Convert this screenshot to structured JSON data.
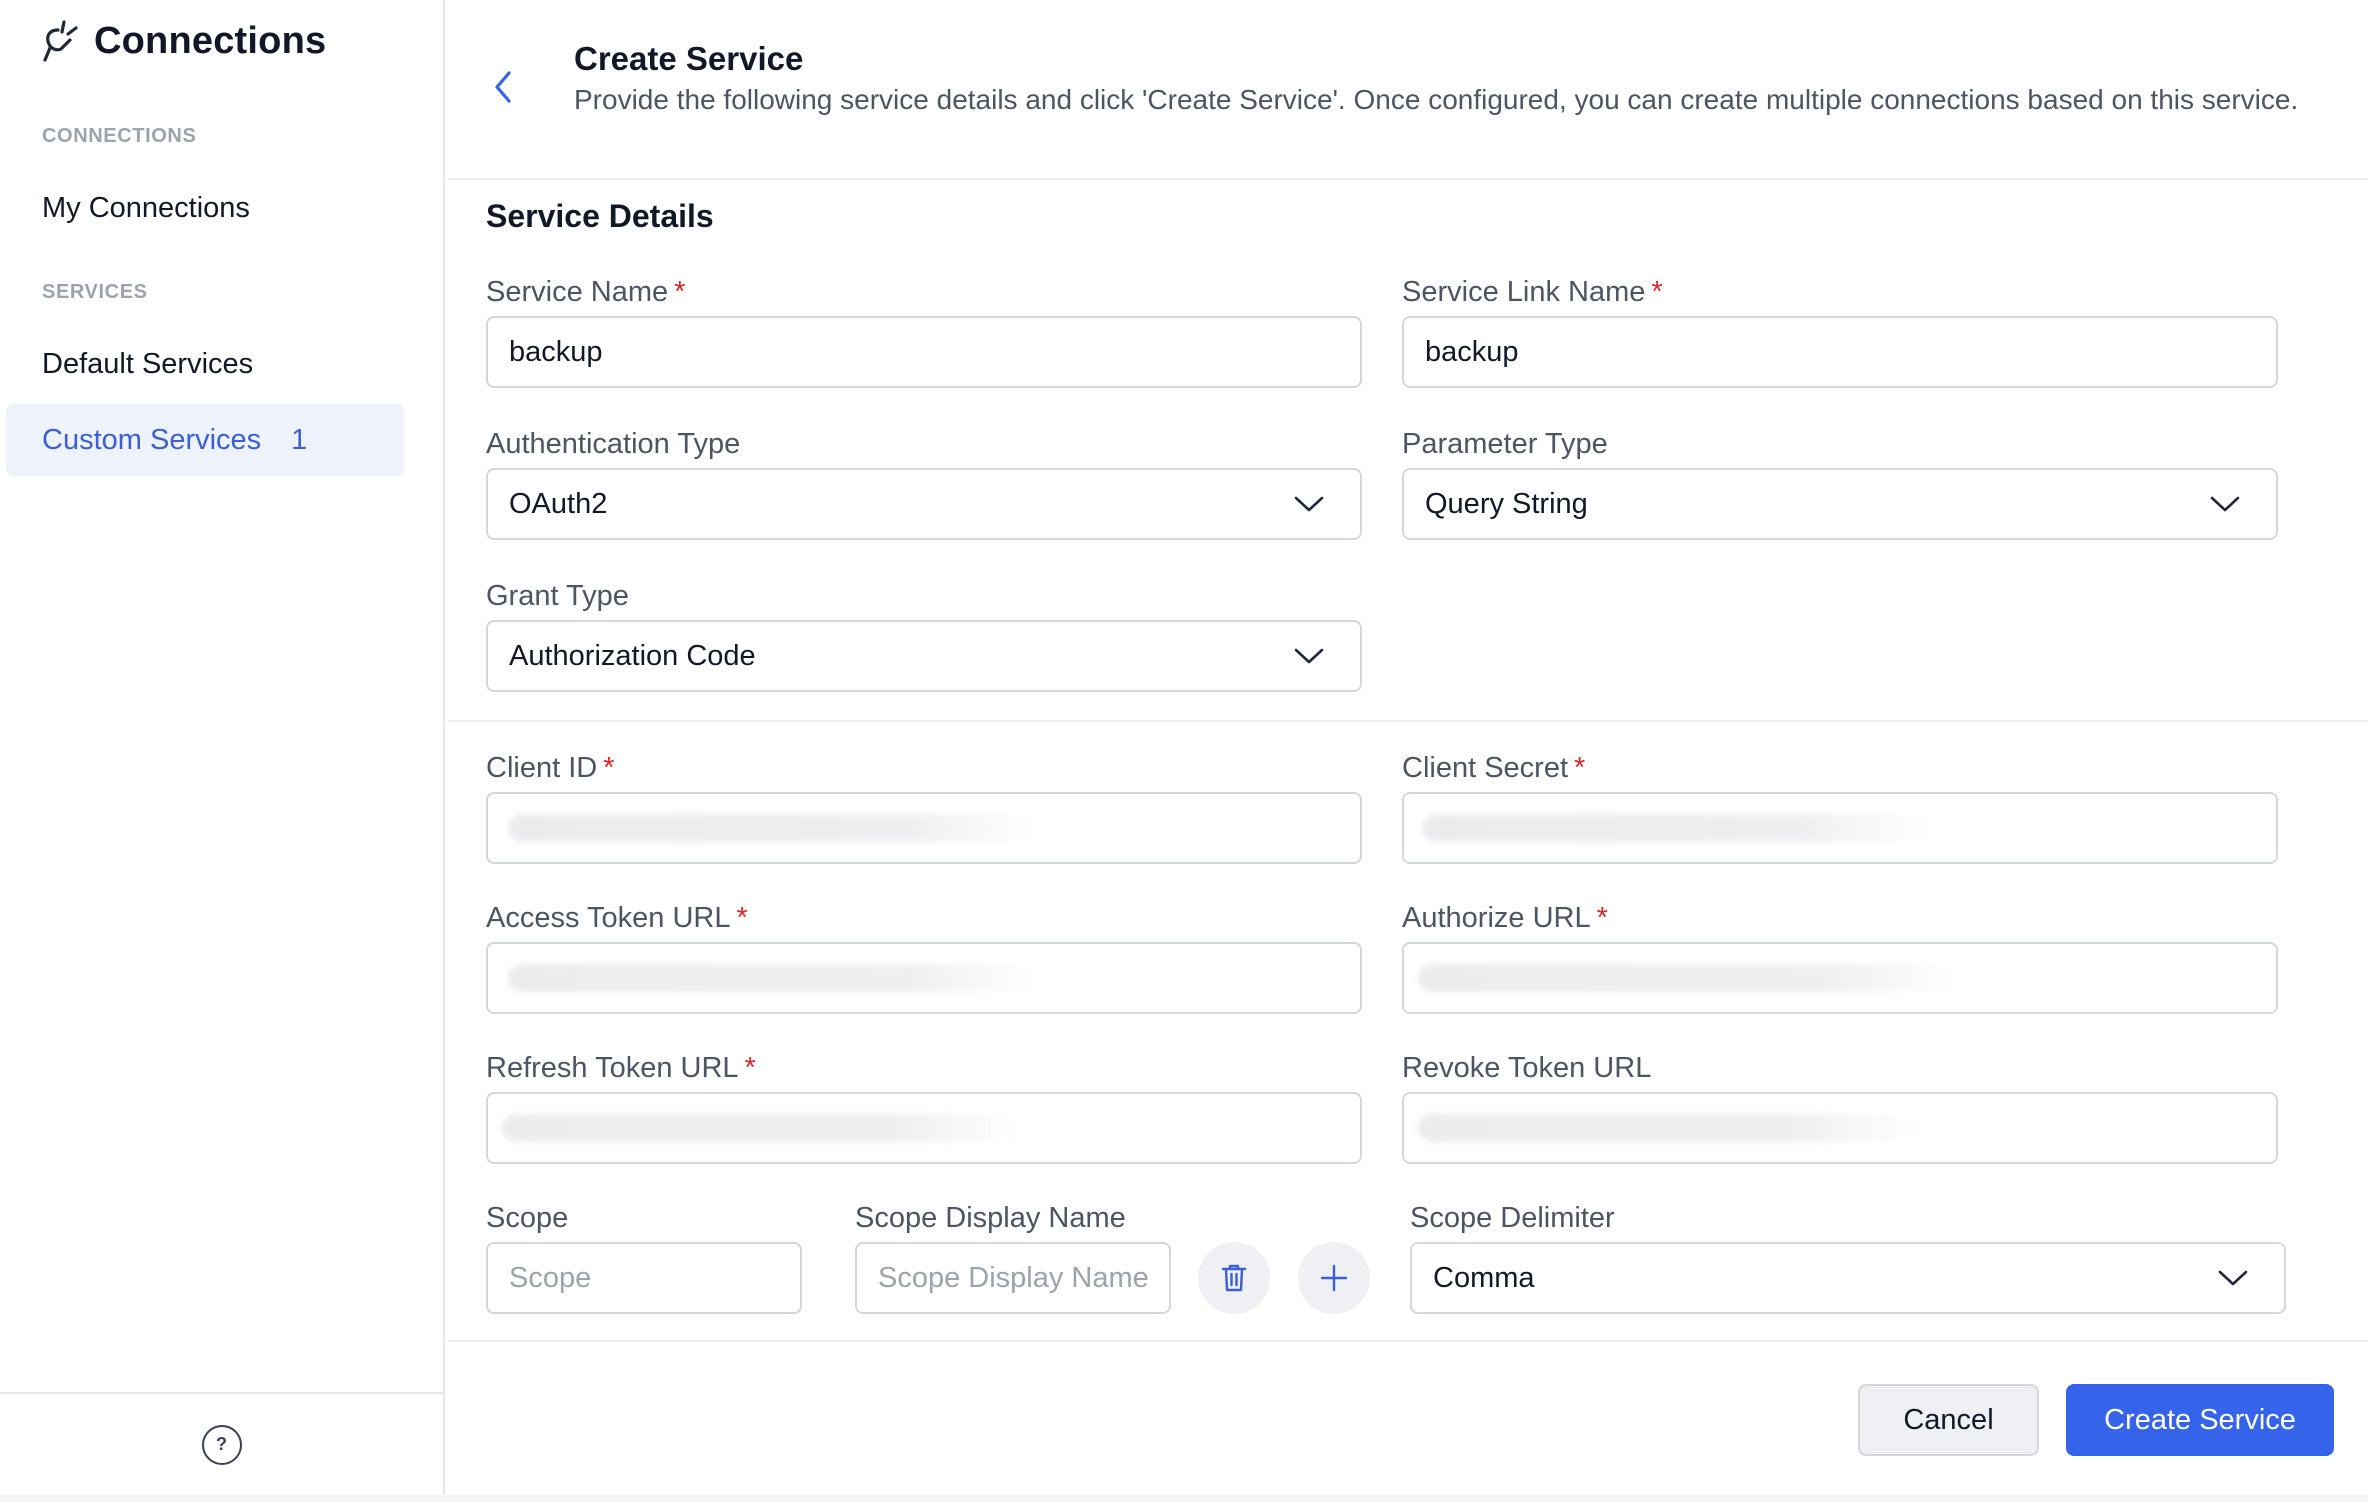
{
  "sidebar": {
    "title": "Connections",
    "sections": [
      {
        "label": "CONNECTIONS",
        "items": [
          {
            "label": "My Connections"
          }
        ]
      },
      {
        "label": "SERVICES",
        "items": [
          {
            "label": "Default Services"
          },
          {
            "label": "Custom Services",
            "count": "1"
          }
        ]
      }
    ],
    "help_label": "?"
  },
  "header": {
    "title": "Create Service",
    "description": "Provide the following service details and click 'Create Service'. Once configured, you can create multiple connections based on this service."
  },
  "form": {
    "section_title": "Service Details",
    "required_mark": "*",
    "service_name": {
      "label": "Service Name",
      "value": "backup"
    },
    "service_link_name": {
      "label": "Service Link Name",
      "value": "backup"
    },
    "authentication_type": {
      "label": "Authentication Type",
      "value": "OAuth2"
    },
    "parameter_type": {
      "label": "Parameter Type",
      "value": "Query String"
    },
    "grant_type": {
      "label": "Grant Type",
      "value": "Authorization Code"
    },
    "client_id": {
      "label": "Client ID"
    },
    "client_secret": {
      "label": "Client Secret"
    },
    "access_token_url": {
      "label": "Access Token URL"
    },
    "authorize_url": {
      "label": "Authorize URL"
    },
    "refresh_token_url": {
      "label": "Refresh Token URL"
    },
    "revoke_token_url": {
      "label": "Revoke Token URL"
    },
    "scope": {
      "label": "Scope",
      "placeholder": "Scope"
    },
    "scope_display_name": {
      "label": "Scope Display Name",
      "placeholder": "Scope Display Name"
    },
    "scope_delimiter": {
      "label": "Scope Delimiter",
      "value": "Comma"
    }
  },
  "footer": {
    "cancel_label": "Cancel",
    "create_label": "Create Service"
  },
  "colors": {
    "accent": "#3563e9",
    "active_nav_bg": "#eef2fb",
    "required": "#dc2626"
  },
  "icons": {
    "brand": "plug-icon",
    "back": "chevron-left-icon",
    "select": "chevron-down-icon",
    "delete": "trash-icon",
    "add": "plus-icon",
    "help": "help-circle-icon"
  }
}
